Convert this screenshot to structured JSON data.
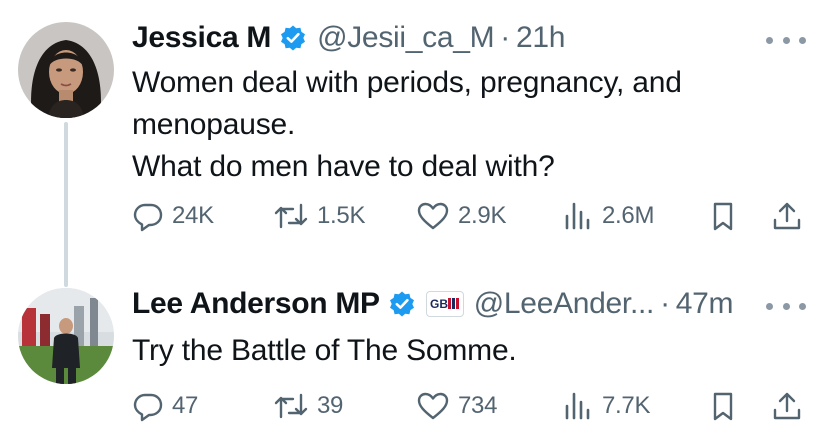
{
  "tweets": [
    {
      "name": "Jessica M",
      "handle": "@Jesii_ca_M",
      "separator": "·",
      "time": "21h",
      "lines": [
        "Women deal with periods, pregnancy, and",
        "menopause.",
        "What do men have to deal with?"
      ],
      "replies": "24K",
      "retweets": "1.5K",
      "likes": "2.9K",
      "views": "2.6M"
    },
    {
      "name": "Lee Anderson MP",
      "affiliate_badge": "GBN",
      "handle": "@LeeAnder...",
      "separator": "·",
      "time": "47m",
      "lines": [
        "Try the Battle of The Somme."
      ],
      "replies": "47",
      "retweets": "39",
      "likes": "734",
      "views": "7.7K"
    }
  ],
  "colors": {
    "verified_blue": "#1d9bf0",
    "text_primary": "#0f1419",
    "text_secondary": "#536471",
    "thread_line": "#cfd9de"
  },
  "icons": [
    "reply-icon",
    "retweet-icon",
    "like-icon",
    "views-icon",
    "bookmark-icon",
    "share-icon",
    "more-icon",
    "verified-badge-icon"
  ]
}
